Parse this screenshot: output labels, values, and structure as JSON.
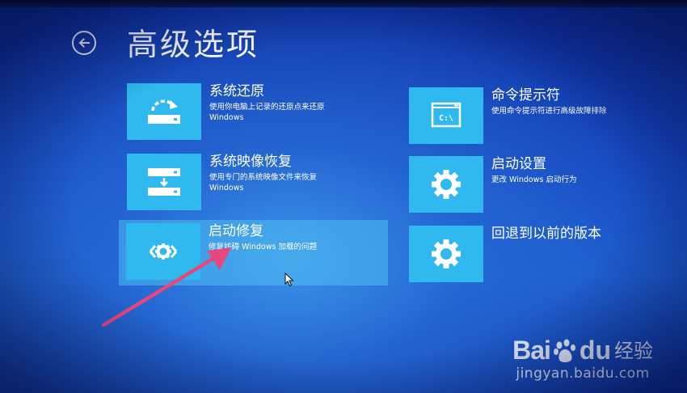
{
  "header": {
    "title": "高级选项"
  },
  "options": {
    "system_restore": {
      "name": "系统还原",
      "desc_line1": "使用你电脑上记录的还原点来还原",
      "desc_line2": "Windows",
      "icon": "restore-icon"
    },
    "system_image": {
      "name": "系统映像恢复",
      "desc_line1": "使用专门的系统映像文件来恢复",
      "desc_line2": "Windows",
      "icon": "image-recovery-icon"
    },
    "startup_repair": {
      "name": "启动修复",
      "desc_line1": "修复妨碍 Windows 加载的问题",
      "icon": "startup-repair-icon"
    },
    "command_prompt": {
      "name": "命令提示符",
      "desc_line1": "使用命令提示符进行高级故障排除",
      "icon": "command-prompt-icon"
    },
    "startup_settings": {
      "name": "启动设置",
      "desc_line1": "更改 Windows 启动行为",
      "icon": "gear-icon"
    },
    "previous_version": {
      "name": "回退到以前的版本",
      "icon": "gear-icon"
    }
  },
  "cmd_icon_text": "C:\\",
  "watermark": {
    "brand_bai": "Bai",
    "brand_du": "du",
    "brand_jingyan": "经验",
    "domain": "jingyan.baidu.com"
  },
  "colors": {
    "tile": "#30b9ee",
    "annotation_arrow": "#e8467c"
  }
}
